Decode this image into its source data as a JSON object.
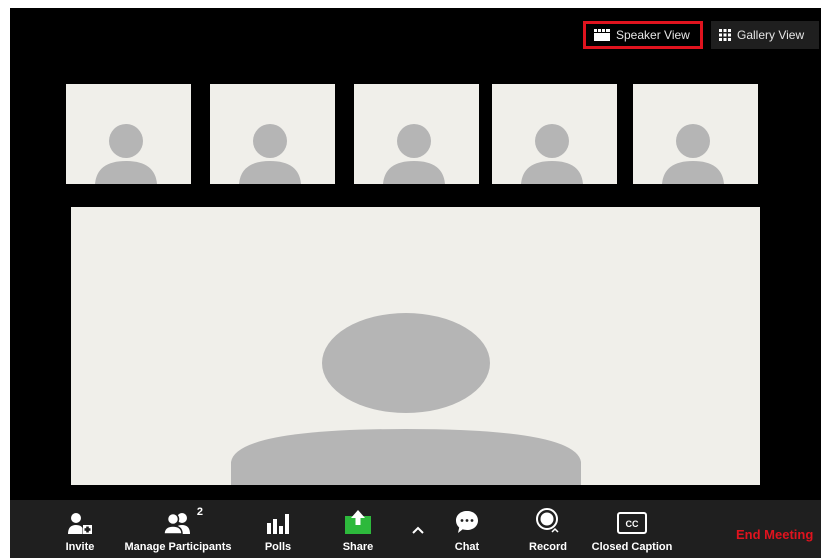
{
  "view_switcher": {
    "speaker_view_label": "Speaker View",
    "gallery_view_label": "Gallery View",
    "active_view": "speaker",
    "highlight_color": "#e0131e"
  },
  "video_tiles": {
    "thumbnail_count": 5,
    "tile_color": "#f0efea",
    "avatar_color": "#b5b5b5"
  },
  "toolbar": {
    "invite_label": "Invite",
    "manage_participants_label": "Manage Participants",
    "participants_count": "2",
    "polls_label": "Polls",
    "share_label": "Share",
    "chat_label": "Chat",
    "record_label": "Record",
    "closed_caption_label": "Closed Caption",
    "closed_caption_icon_text": "CC",
    "end_meeting_label": "End Meeting",
    "icons": {
      "invite": "invite-icon",
      "participants": "participants-icon",
      "polls": "polls-icon",
      "share": "share-icon",
      "more": "chevron-up-icon",
      "chat": "chat-icon",
      "record": "record-icon",
      "closed_caption": "closed-caption-icon"
    },
    "share_color": "#2db93c",
    "end_meeting_color": "#e0131e"
  }
}
